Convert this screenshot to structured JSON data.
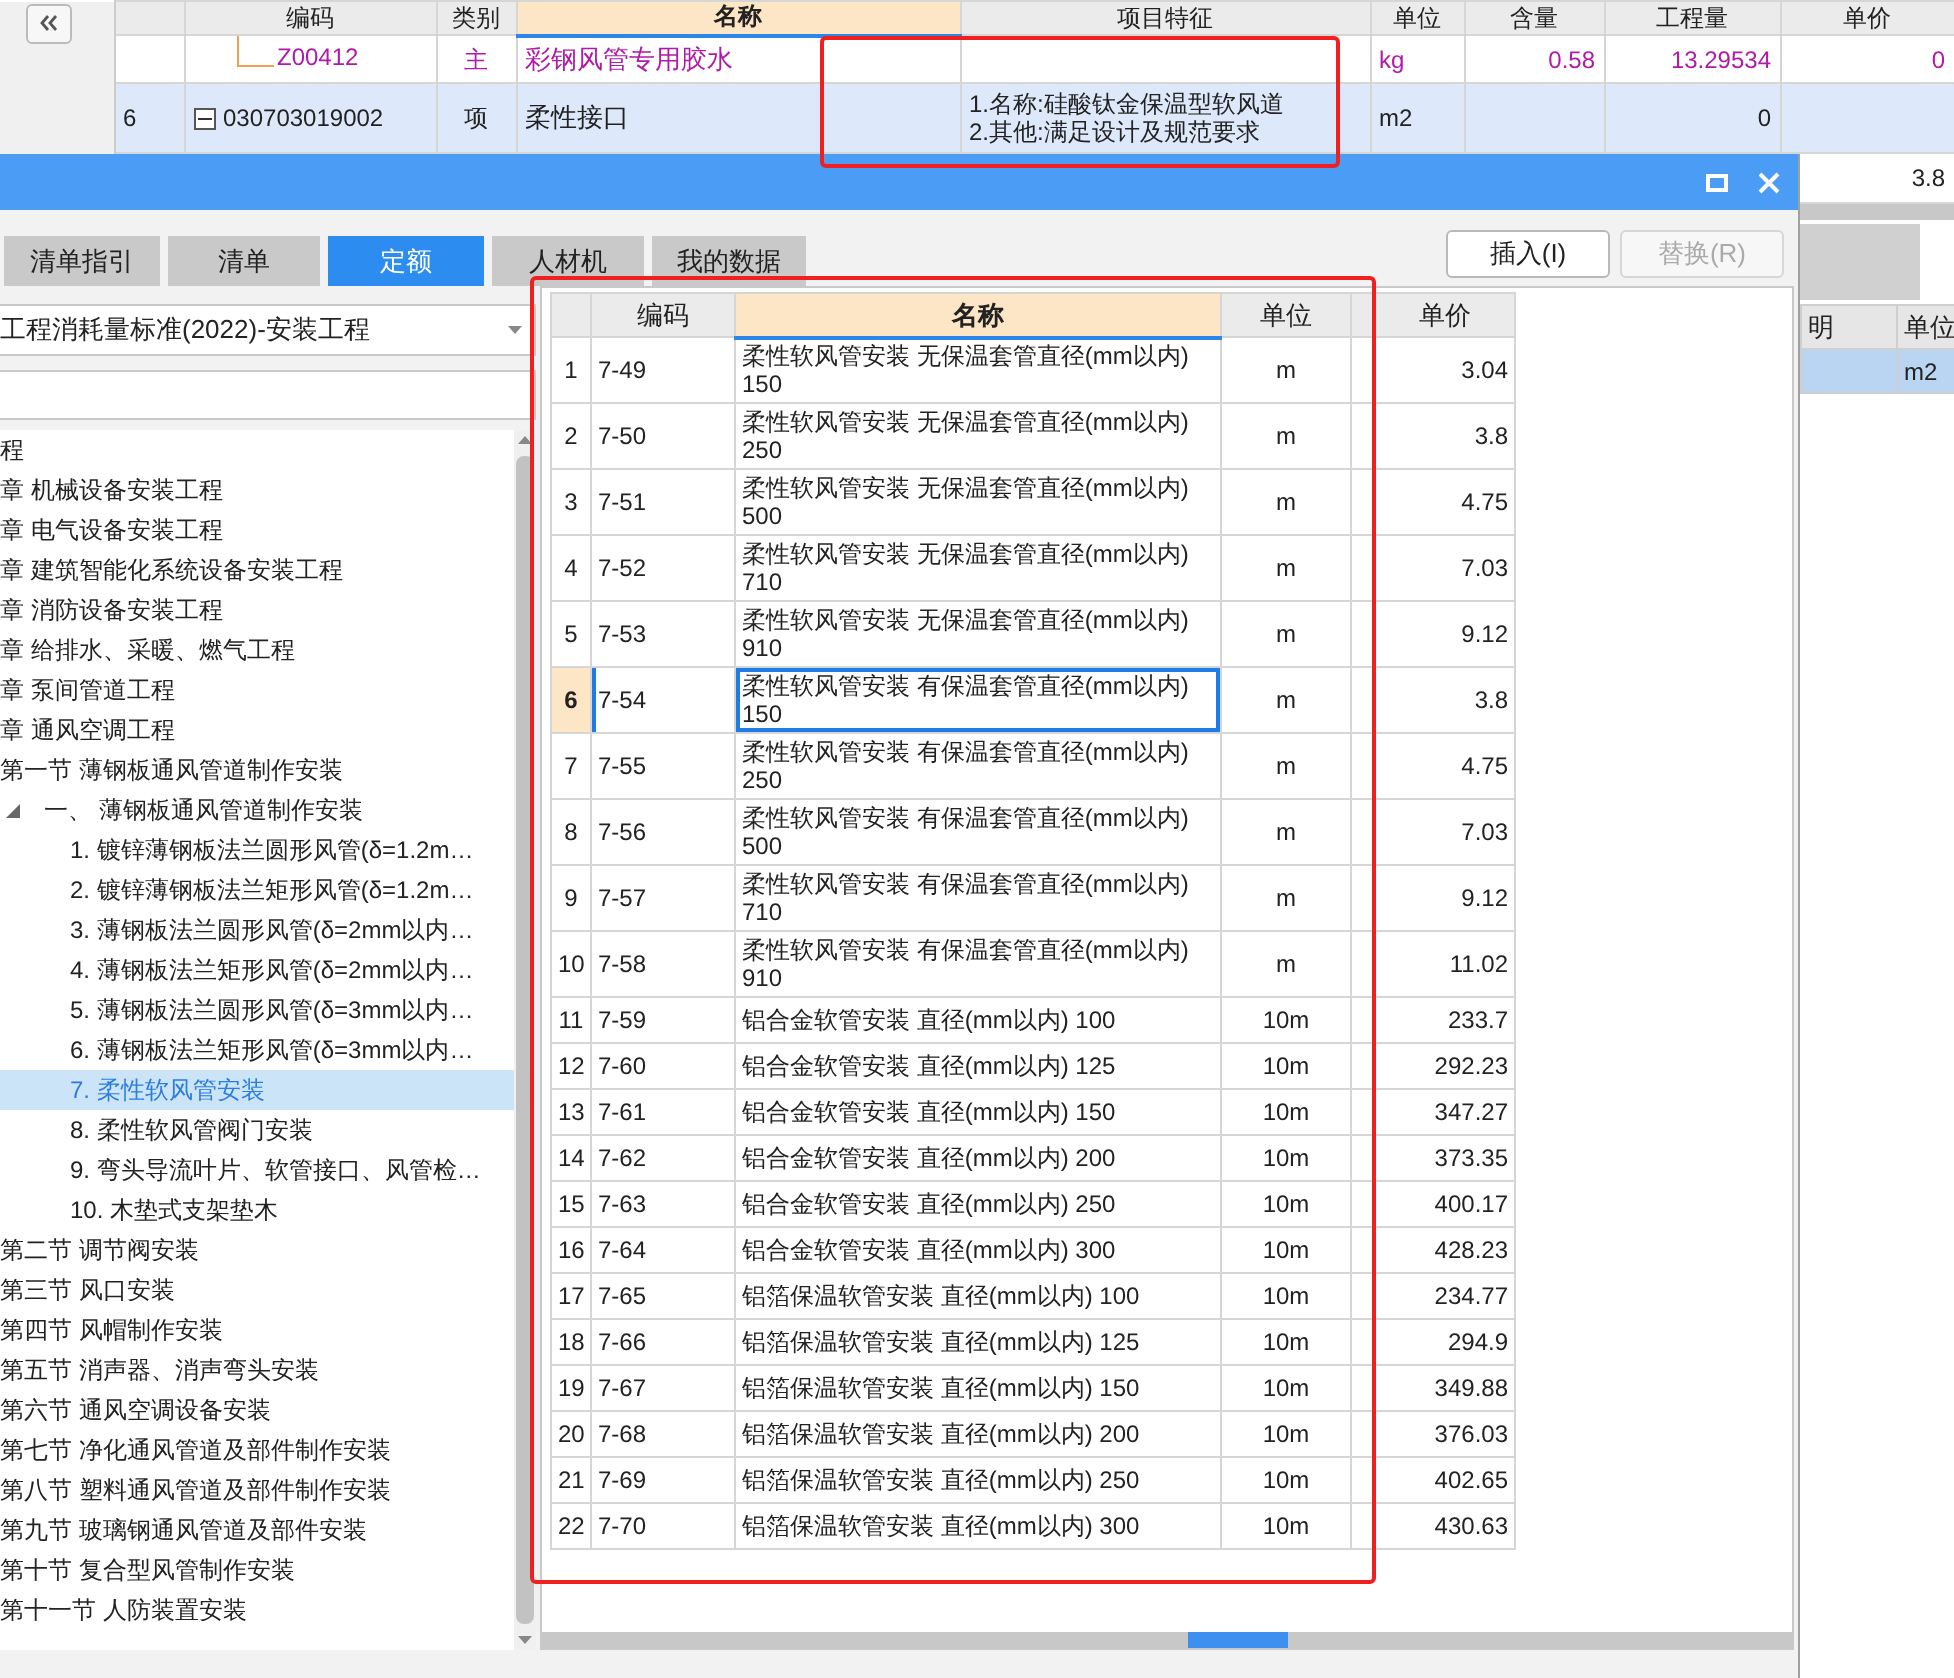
{
  "grid": {
    "columns": [
      {
        "label": "编码",
        "selected": false
      },
      {
        "label": "类别",
        "selected": false
      },
      {
        "label": "名称",
        "selected": true
      },
      {
        "label": "项目特征",
        "selected": false
      },
      {
        "label": "单位",
        "selected": false
      },
      {
        "label": "含量",
        "selected": false
      },
      {
        "label": "工程量",
        "selected": false
      },
      {
        "label": "单价",
        "selected": false
      }
    ],
    "rows": [
      {
        "kind": "material",
        "selected": false,
        "code": "Z00412",
        "type": "主",
        "name": "彩钢风管专用胶水",
        "unit": "kg",
        "content": "0.58",
        "quantity": "13.29534",
        "price": "0"
      },
      {
        "kind": "item",
        "selected": true,
        "seq": "6",
        "expanded": true,
        "code": "030703019002",
        "type": "项",
        "name": "柔性接口",
        "features": [
          "1.名称:硅酸钛金保温型软风道",
          "2.其他:满足设计及规范要求"
        ],
        "unit": "m2",
        "quantity": "0"
      },
      {
        "kind": "item",
        "selected": false,
        "price": "3.8"
      }
    ]
  },
  "side_table": {
    "columns": [
      "明",
      "单位"
    ],
    "rows": [
      {
        "selected": true,
        "unit": "m2"
      }
    ]
  },
  "dialog": {
    "tabs": [
      {
        "label": "清单指引",
        "selected": false
      },
      {
        "label": "清单",
        "selected": false
      },
      {
        "label": "定额",
        "selected": true
      },
      {
        "label": "人材机",
        "selected": false
      },
      {
        "label": "我的数据",
        "selected": false
      }
    ],
    "buttons": [
      {
        "label": "插入(I)",
        "disabled": false
      },
      {
        "label": "替换(R)",
        "disabled": true
      }
    ],
    "library": "工程消耗量标准(2022)-安装工程",
    "tree": [
      {
        "label": "程",
        "selected": false,
        "children": [
          {
            "label": "章 机械设备安装工程",
            "selected": false
          },
          {
            "label": "章 电气设备安装工程",
            "selected": false
          },
          {
            "label": "章 建筑智能化系统设备安装工程",
            "selected": false
          },
          {
            "label": "章 消防设备安装工程",
            "selected": false
          },
          {
            "label": "章 给排水、采暖、燃气工程",
            "selected": false
          },
          {
            "label": "章 泵间管道工程",
            "selected": false
          },
          {
            "label": "章 通风空调工程",
            "selected": false,
            "children": [
              {
                "label": "第一节 薄钢板通风管道制作安装",
                "selected": false,
                "children": [
                  {
                    "label": "一、 薄钢板通风管道制作安装",
                    "selected": false,
                    "expanded": true,
                    "children": [
                      {
                        "label": "1. 镀锌薄钢板法兰圆形风管(δ=1.2m…",
                        "selected": false
                      },
                      {
                        "label": "2. 镀锌薄钢板法兰矩形风管(δ=1.2m…",
                        "selected": false
                      },
                      {
                        "label": "3. 薄钢板法兰圆形风管(δ=2mm以内…",
                        "selected": false
                      },
                      {
                        "label": "4. 薄钢板法兰矩形风管(δ=2mm以内…",
                        "selected": false
                      },
                      {
                        "label": "5. 薄钢板法兰圆形风管(δ=3mm以内…",
                        "selected": false
                      },
                      {
                        "label": "6. 薄钢板法兰矩形风管(δ=3mm以内…",
                        "selected": false
                      },
                      {
                        "label": "7. 柔性软风管安装",
                        "selected": true
                      },
                      {
                        "label": "8. 柔性软风管阀门安装",
                        "selected": false
                      },
                      {
                        "label": "9. 弯头导流叶片、软管接口、风管检…",
                        "selected": false
                      },
                      {
                        "label": "10. 木垫式支架垫木",
                        "selected": false
                      }
                    ]
                  }
                ]
              },
              {
                "label": "第二节 调节阀安装",
                "selected": false
              },
              {
                "label": "第三节 风口安装",
                "selected": false
              },
              {
                "label": "第四节 风帽制作安装",
                "selected": false
              },
              {
                "label": "第五节 消声器、消声弯头安装",
                "selected": false
              },
              {
                "label": "第六节 通风空调设备安装",
                "selected": false
              },
              {
                "label": "第七节 净化通风管道及部件制作安装",
                "selected": false
              },
              {
                "label": "第八节 塑料通风管道及部件制作安装",
                "selected": false
              },
              {
                "label": "第九节 玻璃钢通风管道及部件安装",
                "selected": false
              },
              {
                "label": "第十节 复合型风管制作安装",
                "selected": false
              },
              {
                "label": "第十一节 人防装置安装",
                "selected": false
              }
            ]
          }
        ]
      }
    ],
    "table": {
      "columns": [
        {
          "label": "编码",
          "selected": false
        },
        {
          "label": "名称",
          "selected": true
        },
        {
          "label": "单位",
          "selected": false
        },
        {
          "label": "单价",
          "selected": false
        }
      ],
      "rows": [
        {
          "no": "1",
          "code": "7-49",
          "name": "柔性软风管安装 无保温套管直径(mm以内)\n150",
          "unit": "m",
          "price": "3.04",
          "selected": false
        },
        {
          "no": "2",
          "code": "7-50",
          "name": "柔性软风管安装 无保温套管直径(mm以内)\n250",
          "unit": "m",
          "price": "3.8",
          "selected": false
        },
        {
          "no": "3",
          "code": "7-51",
          "name": "柔性软风管安装 无保温套管直径(mm以内)\n500",
          "unit": "m",
          "price": "4.75",
          "selected": false
        },
        {
          "no": "4",
          "code": "7-52",
          "name": "柔性软风管安装 无保温套管直径(mm以内)\n710",
          "unit": "m",
          "price": "7.03",
          "selected": false
        },
        {
          "no": "5",
          "code": "7-53",
          "name": "柔性软风管安装 无保温套管直径(mm以内)\n910",
          "unit": "m",
          "price": "9.12",
          "selected": false
        },
        {
          "no": "6",
          "code": "7-54",
          "name": "柔性软风管安装 有保温套管直径(mm以内)\n150",
          "unit": "m",
          "price": "3.8",
          "selected": true
        },
        {
          "no": "7",
          "code": "7-55",
          "name": "柔性软风管安装 有保温套管直径(mm以内)\n250",
          "unit": "m",
          "price": "4.75",
          "selected": false
        },
        {
          "no": "8",
          "code": "7-56",
          "name": "柔性软风管安装 有保温套管直径(mm以内)\n500",
          "unit": "m",
          "price": "7.03",
          "selected": false
        },
        {
          "no": "9",
          "code": "7-57",
          "name": "柔性软风管安装 有保温套管直径(mm以内)\n710",
          "unit": "m",
          "price": "9.12",
          "selected": false
        },
        {
          "no": "10",
          "code": "7-58",
          "name": "柔性软风管安装 有保温套管直径(mm以内)\n910",
          "unit": "m",
          "price": "11.02",
          "selected": false
        },
        {
          "no": "11",
          "code": "7-59",
          "name": "铝合金软管安装 直径(mm以内) 100",
          "unit": "10m",
          "price": "233.7",
          "selected": false
        },
        {
          "no": "12",
          "code": "7-60",
          "name": "铝合金软管安装 直径(mm以内) 125",
          "unit": "10m",
          "price": "292.23",
          "selected": false
        },
        {
          "no": "13",
          "code": "7-61",
          "name": "铝合金软管安装 直径(mm以内) 150",
          "unit": "10m",
          "price": "347.27",
          "selected": false
        },
        {
          "no": "14",
          "code": "7-62",
          "name": "铝合金软管安装 直径(mm以内) 200",
          "unit": "10m",
          "price": "373.35",
          "selected": false
        },
        {
          "no": "15",
          "code": "7-63",
          "name": "铝合金软管安装 直径(mm以内) 250",
          "unit": "10m",
          "price": "400.17",
          "selected": false
        },
        {
          "no": "16",
          "code": "7-64",
          "name": "铝合金软管安装 直径(mm以内) 300",
          "unit": "10m",
          "price": "428.23",
          "selected": false
        },
        {
          "no": "17",
          "code": "7-65",
          "name": "铝箔保温软管安装 直径(mm以内) 100",
          "unit": "10m",
          "price": "234.77",
          "selected": false
        },
        {
          "no": "18",
          "code": "7-66",
          "name": "铝箔保温软管安装 直径(mm以内) 125",
          "unit": "10m",
          "price": "294.9",
          "selected": false
        },
        {
          "no": "19",
          "code": "7-67",
          "name": "铝箔保温软管安装 直径(mm以内) 150",
          "unit": "10m",
          "price": "349.88",
          "selected": false
        },
        {
          "no": "20",
          "code": "7-68",
          "name": "铝箔保温软管安装 直径(mm以内) 200",
          "unit": "10m",
          "price": "376.03",
          "selected": false
        },
        {
          "no": "21",
          "code": "7-69",
          "name": "铝箔保温软管安装 直径(mm以内) 250",
          "unit": "10m",
          "price": "402.65",
          "selected": false
        },
        {
          "no": "22",
          "code": "7-70",
          "name": "铝箔保温软管安装 直径(mm以内) 300",
          "unit": "10m",
          "price": "430.63",
          "selected": false
        }
      ]
    }
  }
}
